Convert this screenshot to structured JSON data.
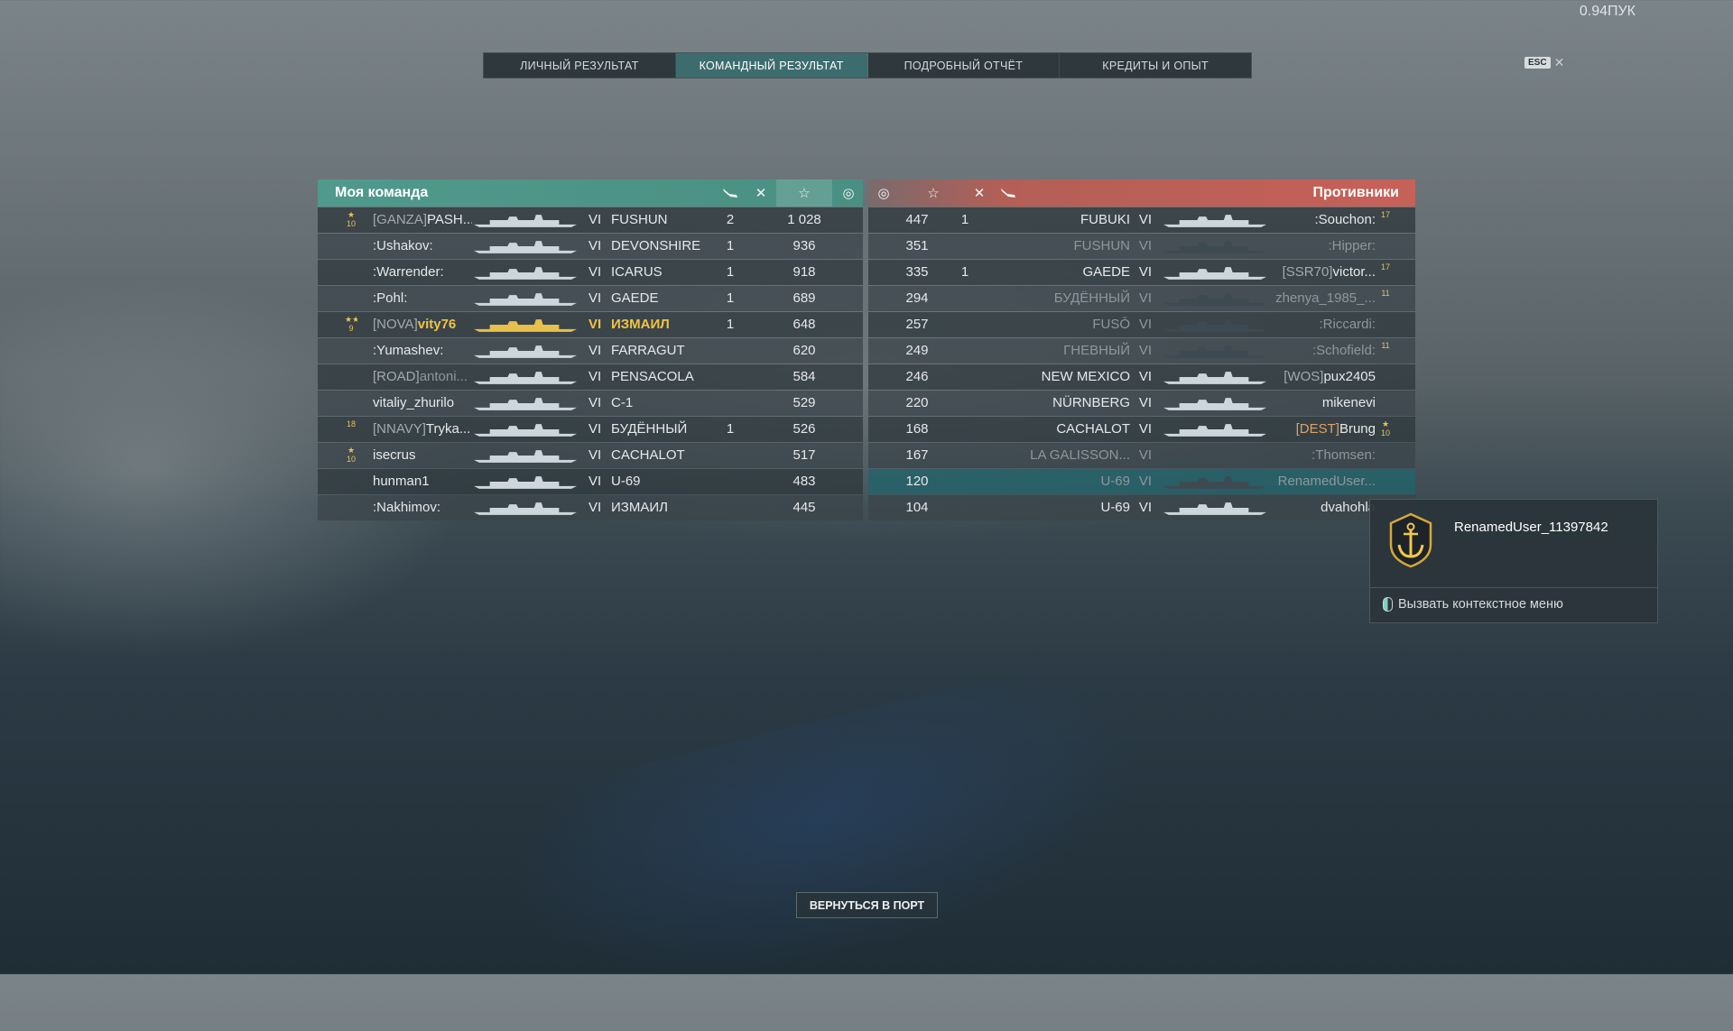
{
  "version": "0.94ПУК",
  "esc": {
    "key": "ESC",
    "close": "✕"
  },
  "tabs": [
    {
      "label": "ЛИЧНЫЙ РЕЗУЛЬТАТ",
      "active": false
    },
    {
      "label": "КОМАНДНЫЙ РЕЗУЛЬТАТ",
      "active": true
    },
    {
      "label": "ПОДРОБНЫЙ ОТЧЁТ",
      "active": false
    },
    {
      "label": "КРЕДИТЫ И ОПЫТ",
      "active": false
    }
  ],
  "my_team": {
    "title": "Моя команда",
    "header_icons": [
      "plane-icon",
      "crossed-swords-icon",
      "star-icon",
      "base-capture-icon"
    ],
    "rows": [
      {
        "rank": "★\n10",
        "clan": "[GANZA]",
        "player": "PASH...",
        "tier": "VI",
        "ship": "FUSHUN",
        "kills": "2",
        "xp": "1 028"
      },
      {
        "rank": "",
        "clan": "",
        "player": ":Ushakov:",
        "tier": "VI",
        "ship": "DEVONSHIRE",
        "kills": "1",
        "xp": "936"
      },
      {
        "rank": "",
        "clan": "",
        "player": ":Warrender:",
        "tier": "VI",
        "ship": "ICARUS",
        "kills": "1",
        "xp": "918"
      },
      {
        "rank": "",
        "clan": "",
        "player": ":Pohl:",
        "tier": "VI",
        "ship": "GAEDE",
        "kills": "1",
        "xp": "689"
      },
      {
        "rank": "★★\n9",
        "clan": "[NOVA]",
        "player": "vity76",
        "tier": "VI",
        "ship": "ИЗМАИЛ",
        "kills": "1",
        "xp": "648"
      },
      {
        "rank": "",
        "clan": "",
        "player": ":Yumashev:",
        "tier": "VI",
        "ship": "FARRAGUT",
        "kills": "",
        "xp": "620"
      },
      {
        "rank": "",
        "clan": "[ROAD]",
        "player": "antoni...",
        "tier": "VI",
        "ship": "PENSACOLA",
        "kills": "",
        "xp": "584"
      },
      {
        "rank": "",
        "clan": "",
        "player": "vitaliy_zhurilo",
        "tier": "VI",
        "ship": "C-1",
        "kills": "",
        "xp": "529"
      },
      {
        "rank": "18",
        "clan": "[NNAVY]",
        "player": "Tryka...",
        "tier": "VI",
        "ship": "БУДЁННЫЙ",
        "kills": "1",
        "xp": "526"
      },
      {
        "rank": "★\n10",
        "clan": "",
        "player": "isecrus",
        "tier": "VI",
        "ship": "CACHALOT",
        "kills": "",
        "xp": "517"
      },
      {
        "rank": "",
        "clan": "",
        "player": "hunman1",
        "tier": "VI",
        "ship": "U-69",
        "kills": "",
        "xp": "483"
      },
      {
        "rank": "",
        "clan": "",
        "player": ":Nakhimov:",
        "tier": "VI",
        "ship": "ИЗМАИЛ",
        "kills": "",
        "xp": "445"
      }
    ]
  },
  "enemies": {
    "title": "Противники",
    "header_icons": [
      "base-capture-icon",
      "star-icon",
      "crossed-swords-icon",
      "plane-icon"
    ],
    "rows": [
      {
        "xp": "447",
        "kills": "1",
        "ship": "FUBUKI",
        "tier": "VI",
        "clan": "",
        "player": ":Souchon:",
        "rank": "17"
      },
      {
        "xp": "351",
        "kills": "",
        "ship": "FUSHUN",
        "tier": "VI",
        "clan": "",
        "player": ":Hipper:",
        "rank": ""
      },
      {
        "xp": "335",
        "kills": "1",
        "ship": "GAEDE",
        "tier": "VI",
        "clan": "[SSR70]",
        "player": "victor...",
        "rank": "17"
      },
      {
        "xp": "294",
        "kills": "",
        "ship": "БУДЁННЫЙ",
        "tier": "VI",
        "clan": "",
        "player": "zhenya_1985_...",
        "rank": "11"
      },
      {
        "xp": "257",
        "kills": "",
        "ship": "FUSŌ",
        "tier": "VI",
        "clan": "",
        "player": ":Riccardi:",
        "rank": ""
      },
      {
        "xp": "249",
        "kills": "",
        "ship": "ГНЕВНЫЙ",
        "tier": "VI",
        "clan": "",
        "player": ":Schofield:",
        "rank": "11"
      },
      {
        "xp": "246",
        "kills": "",
        "ship": "NEW MEXICO",
        "tier": "VI",
        "clan": "[WOS]",
        "player": "pux2405",
        "rank": ""
      },
      {
        "xp": "220",
        "kills": "",
        "ship": "NÜRNBERG",
        "tier": "VI",
        "clan": "",
        "player": "mikenevi",
        "rank": ""
      },
      {
        "xp": "168",
        "kills": "",
        "ship": "CACHALOT",
        "tier": "VI",
        "clan": "[DEST]",
        "player": "Brung",
        "rank": "★\n10"
      },
      {
        "xp": "167",
        "kills": "",
        "ship": "LA GALISSON...",
        "tier": "VI",
        "clan": "",
        "player": ":Thomsen:",
        "rank": ""
      },
      {
        "xp": "120",
        "kills": "",
        "ship": "U-69",
        "tier": "VI",
        "clan": "",
        "player": "RenamedUser...",
        "rank": ""
      },
      {
        "xp": "104",
        "kills": "",
        "ship": "U-69",
        "tier": "VI",
        "clan": "",
        "player": "dvahohla",
        "rank": ""
      }
    ]
  },
  "tooltip": {
    "name": "RenamedUser_11397842",
    "hint": "Вызвать контекстное меню",
    "emblem": "anchor-icon"
  },
  "back_button": "ВЕРНУТЬСЯ В ПОРТ",
  "colors": {
    "my_team": "#4f9a8c",
    "enemies": "#c66158",
    "highlight_player": "#f0c344",
    "active_tab": "#3d6c6e"
  }
}
